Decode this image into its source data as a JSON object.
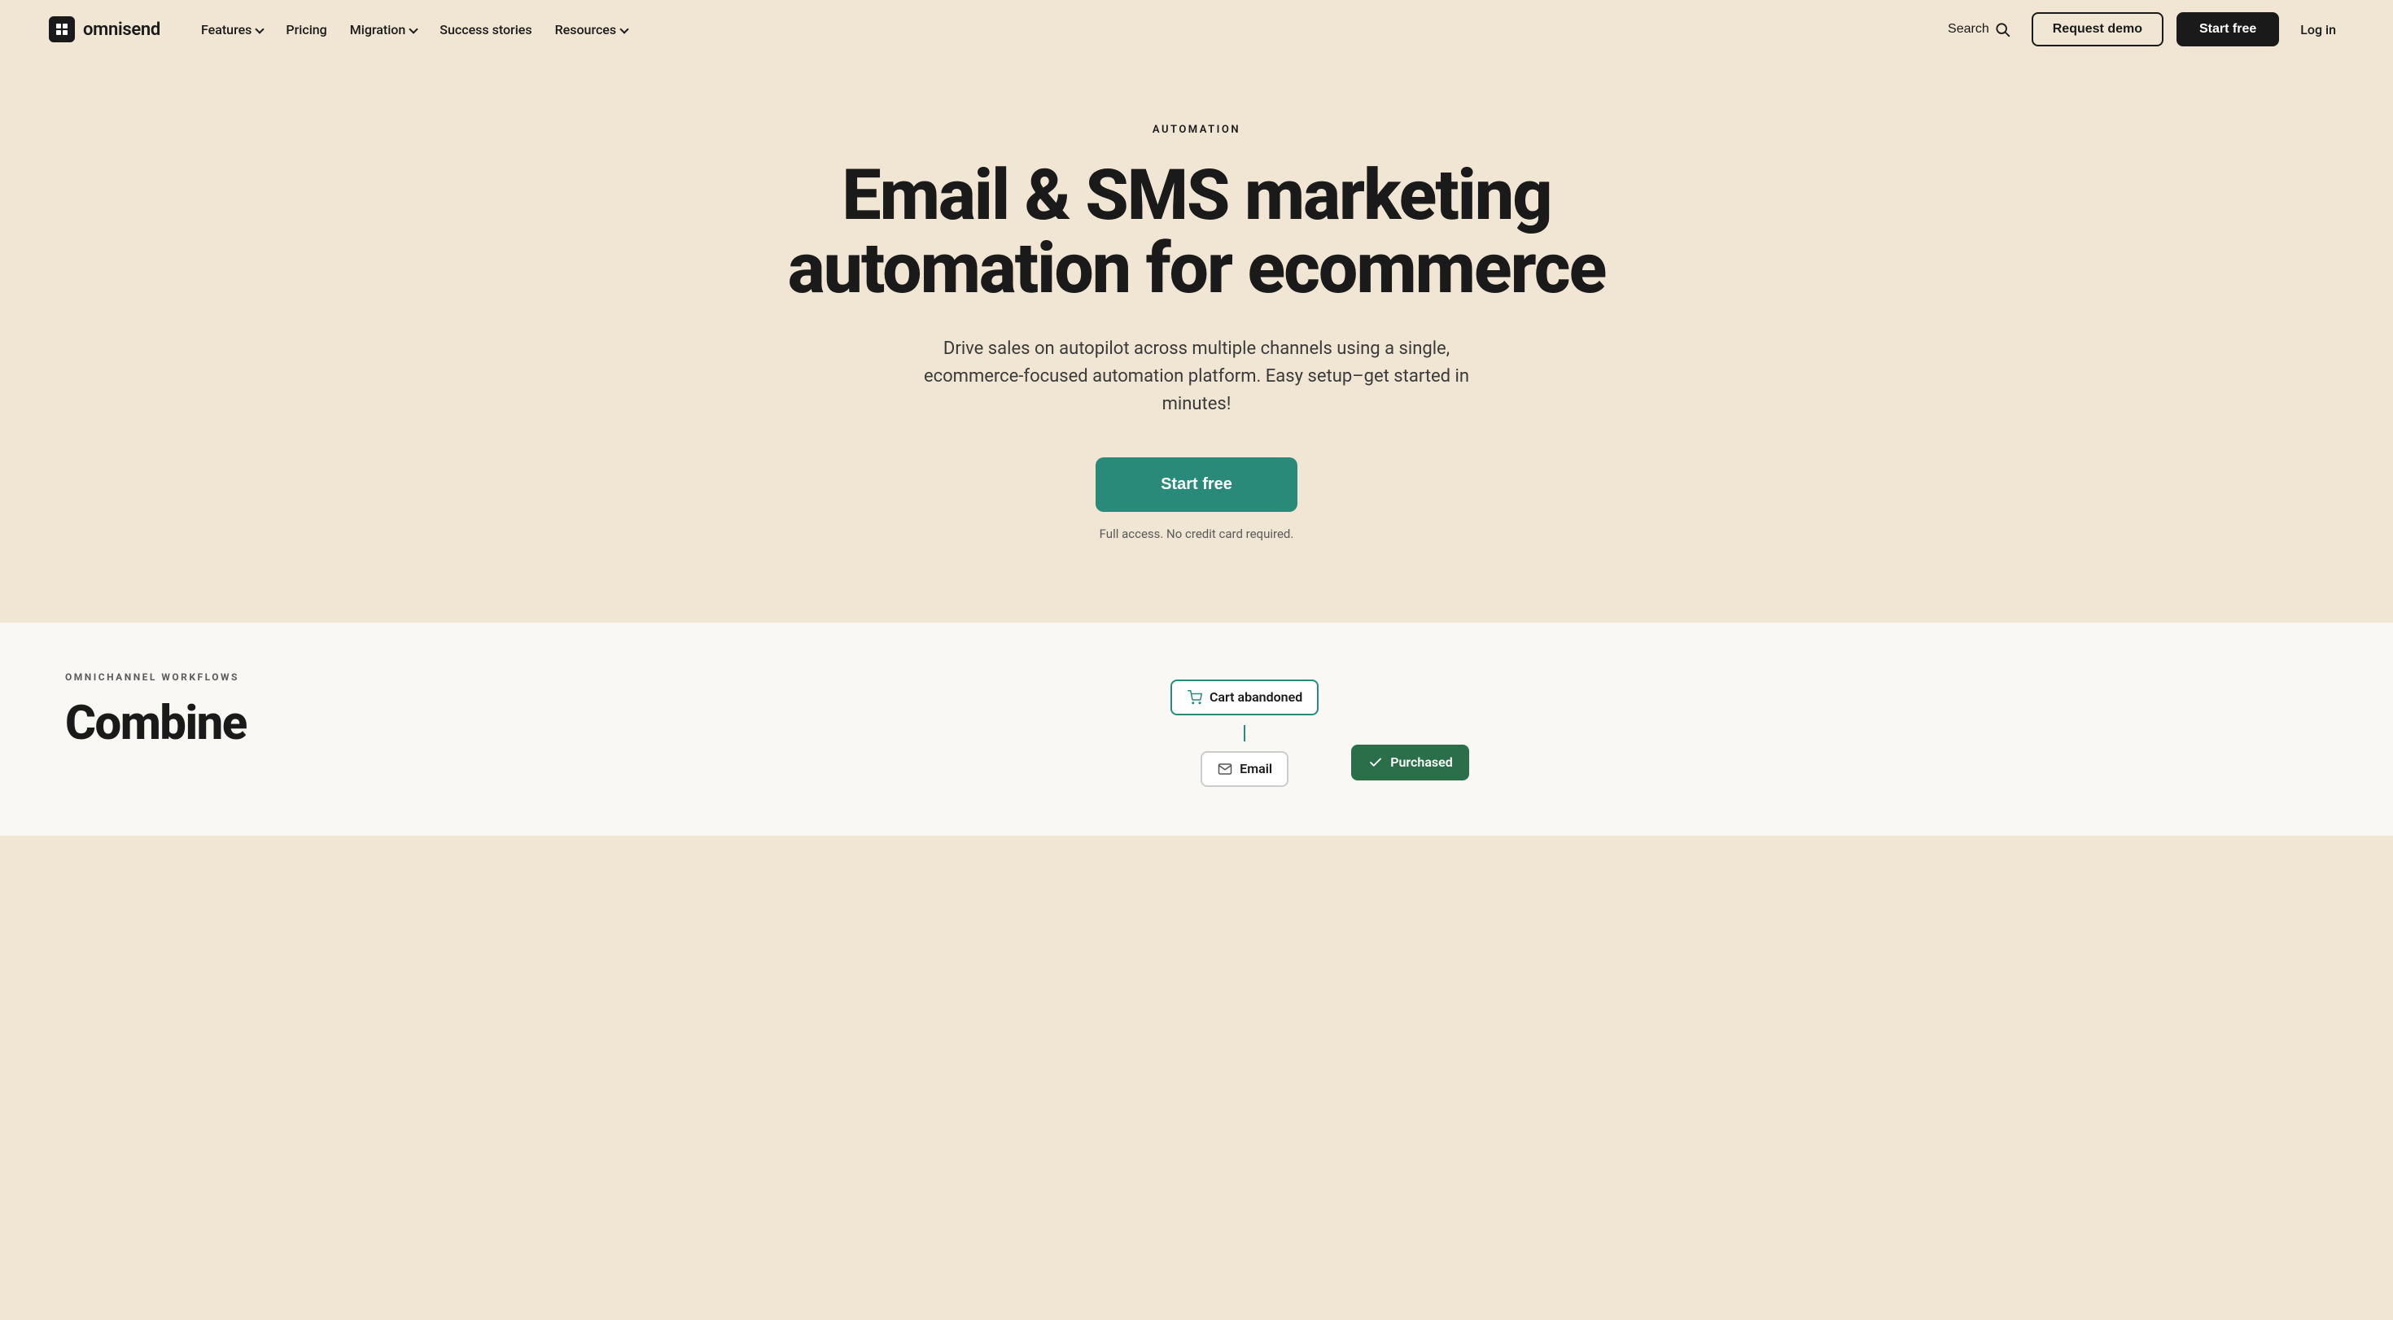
{
  "brand": {
    "name": "omnisend",
    "logo_alt": "Omnisend logo"
  },
  "navbar": {
    "features_label": "Features",
    "pricing_label": "Pricing",
    "migration_label": "Migration",
    "success_stories_label": "Success stories",
    "resources_label": "Resources",
    "search_label": "Search",
    "request_demo_label": "Request demo",
    "start_free_label": "Start free",
    "login_label": "Log in"
  },
  "hero": {
    "eyebrow": "AUTOMATION",
    "title_line1": "Email & SMS marketing",
    "title_line2": "automation for ecommerce",
    "subtitle": "Drive sales on autopilot across multiple channels using a single, ecommerce-focused automation platform. Easy setup–get started in minutes!",
    "cta_label": "Start free",
    "disclaimer": "Full access. No credit card required."
  },
  "lower_section": {
    "eyebrow": "OMNICHANNEL WORKFLOWS",
    "title": "Combine",
    "workflow": {
      "cart_abandoned_label": "Cart abandoned",
      "email_label": "Email",
      "purchased_label": "Purchased"
    }
  }
}
